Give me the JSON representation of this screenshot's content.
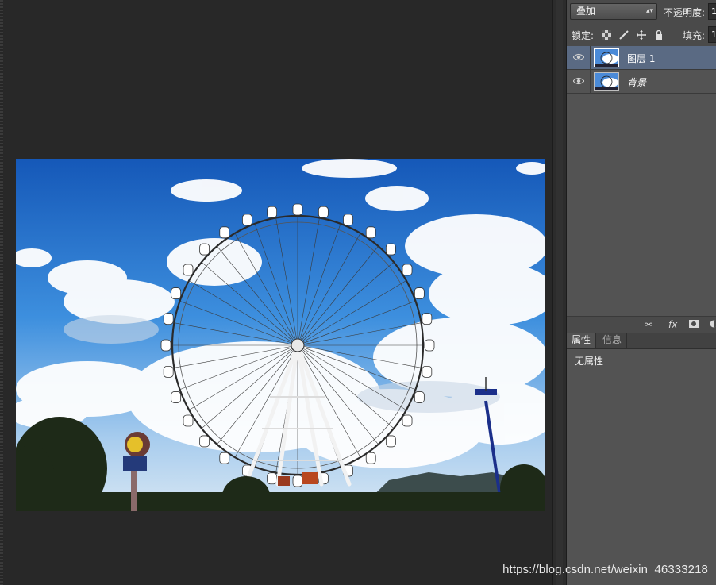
{
  "options_bar": {
    "blend_mode": "叠加",
    "opacity_label": "不透明度:",
    "opacity_value": "1"
  },
  "lock_bar": {
    "lock_label": "锁定:",
    "fill_label": "填充:",
    "fill_value": "1"
  },
  "layers": [
    {
      "name": "图层 1",
      "selected": true,
      "visible": true
    },
    {
      "name": "背景",
      "selected": false,
      "visible": true
    }
  ],
  "properties": {
    "tabs": [
      "属性",
      "信息"
    ],
    "content": "无属性"
  },
  "watermark": "https://blog.csdn.net/weixin_46333218",
  "colors": {
    "selected_layer": "#5a6a83",
    "panel_bg": "#535353",
    "workspace_bg": "#282828"
  }
}
